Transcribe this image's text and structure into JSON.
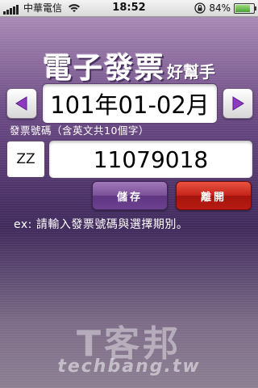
{
  "status_bar": {
    "carrier": "中華電信",
    "time": "18:52",
    "battery_percent": "84%",
    "battery_level": 0.84
  },
  "app": {
    "title_main": "電子發票",
    "title_sub": "好幫手"
  },
  "period_selector": {
    "value": "101年01-02月"
  },
  "invoice": {
    "hint": "發票號碼（含英文共10個字）",
    "prefix": "ZZ",
    "number": "11079018"
  },
  "buttons": {
    "save_label": "儲存",
    "open_label": "離開"
  },
  "instruction": "ex: 請輸入發票號碼與選擇期別。",
  "watermark": {
    "cn": "T客邦",
    "en": "techbang.tw"
  },
  "colors": {
    "accent_purple": "#7a4f98",
    "danger_red": "#c4241a"
  }
}
